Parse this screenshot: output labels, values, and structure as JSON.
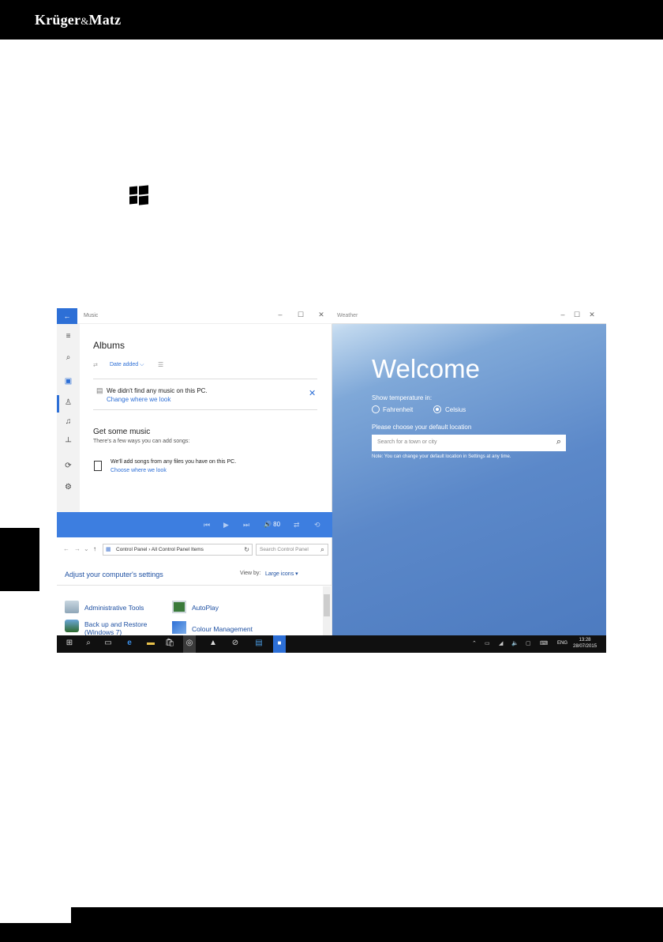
{
  "brand": {
    "name": "Krüger",
    "amp": "&",
    "name2": "Matz"
  },
  "music": {
    "window_title": "Music",
    "heading": "Albums",
    "sort_label": "Date added ⌵",
    "notice": "We didn't find any music on this PC.",
    "notice_link": "Change where we look",
    "get_heading": "Get some music",
    "get_subtitle": "There's a few ways you can add songs:",
    "add_text": "We'll add songs from any files you have on this PC.",
    "add_link": "Choose where we look",
    "volume": "🔊 80",
    "controls": [
      "⏮",
      "▶",
      "⏭",
      "⇄",
      "⟲"
    ]
  },
  "weather": {
    "window_title": "Weather",
    "welcome": "Welcome",
    "temp_label": "Show temperature in:",
    "fahrenheit": "Fahrenheit",
    "celsius": "Celsius",
    "selected_unit": "Celsius",
    "location_label": "Please choose your default location",
    "search_placeholder": "Search for a town or city",
    "note": "Note: You can change your default location in Settings at any time."
  },
  "control_panel": {
    "address": "Control Panel  ›  All Control Panel Items",
    "search_placeholder": "Search Control Panel",
    "heading": "Adjust your computer's settings",
    "view_by_label": "View by:",
    "view_by_value": "Large icons ▾",
    "items": [
      {
        "label": "Administrative Tools"
      },
      {
        "label": "AutoPlay"
      },
      {
        "label": "Back up and Restore (Windows 7)"
      },
      {
        "label": "Colour Management"
      }
    ]
  },
  "taskbar": {
    "lang": "ENG",
    "time": "13:28",
    "date": "28/07/2015"
  },
  "colors": {
    "accent": "#2d6fd6",
    "player": "#3d7ee0",
    "weather_sky": "#5b88c9",
    "taskbar": "#101010",
    "link": "#1e50a2"
  }
}
